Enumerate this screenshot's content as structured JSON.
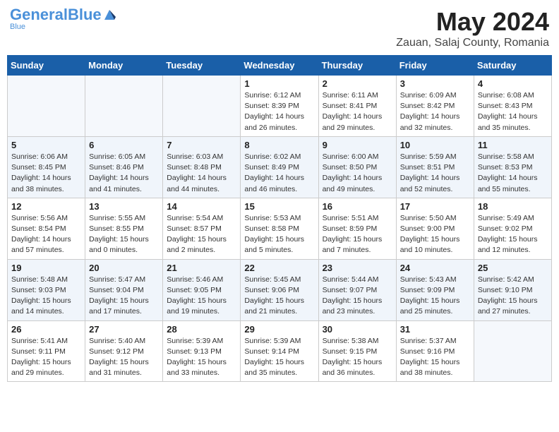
{
  "header": {
    "logo_general": "General",
    "logo_blue": "Blue",
    "month_title": "May 2024",
    "subtitle": "Zauan, Salaj County, Romania"
  },
  "days_of_week": [
    "Sunday",
    "Monday",
    "Tuesday",
    "Wednesday",
    "Thursday",
    "Friday",
    "Saturday"
  ],
  "weeks": [
    [
      {
        "day": "",
        "info": ""
      },
      {
        "day": "",
        "info": ""
      },
      {
        "day": "",
        "info": ""
      },
      {
        "day": "1",
        "info": "Sunrise: 6:12 AM\nSunset: 8:39 PM\nDaylight: 14 hours and 26 minutes."
      },
      {
        "day": "2",
        "info": "Sunrise: 6:11 AM\nSunset: 8:41 PM\nDaylight: 14 hours and 29 minutes."
      },
      {
        "day": "3",
        "info": "Sunrise: 6:09 AM\nSunset: 8:42 PM\nDaylight: 14 hours and 32 minutes."
      },
      {
        "day": "4",
        "info": "Sunrise: 6:08 AM\nSunset: 8:43 PM\nDaylight: 14 hours and 35 minutes."
      }
    ],
    [
      {
        "day": "5",
        "info": "Sunrise: 6:06 AM\nSunset: 8:45 PM\nDaylight: 14 hours and 38 minutes."
      },
      {
        "day": "6",
        "info": "Sunrise: 6:05 AM\nSunset: 8:46 PM\nDaylight: 14 hours and 41 minutes."
      },
      {
        "day": "7",
        "info": "Sunrise: 6:03 AM\nSunset: 8:48 PM\nDaylight: 14 hours and 44 minutes."
      },
      {
        "day": "8",
        "info": "Sunrise: 6:02 AM\nSunset: 8:49 PM\nDaylight: 14 hours and 46 minutes."
      },
      {
        "day": "9",
        "info": "Sunrise: 6:00 AM\nSunset: 8:50 PM\nDaylight: 14 hours and 49 minutes."
      },
      {
        "day": "10",
        "info": "Sunrise: 5:59 AM\nSunset: 8:51 PM\nDaylight: 14 hours and 52 minutes."
      },
      {
        "day": "11",
        "info": "Sunrise: 5:58 AM\nSunset: 8:53 PM\nDaylight: 14 hours and 55 minutes."
      }
    ],
    [
      {
        "day": "12",
        "info": "Sunrise: 5:56 AM\nSunset: 8:54 PM\nDaylight: 14 hours and 57 minutes."
      },
      {
        "day": "13",
        "info": "Sunrise: 5:55 AM\nSunset: 8:55 PM\nDaylight: 15 hours and 0 minutes."
      },
      {
        "day": "14",
        "info": "Sunrise: 5:54 AM\nSunset: 8:57 PM\nDaylight: 15 hours and 2 minutes."
      },
      {
        "day": "15",
        "info": "Sunrise: 5:53 AM\nSunset: 8:58 PM\nDaylight: 15 hours and 5 minutes."
      },
      {
        "day": "16",
        "info": "Sunrise: 5:51 AM\nSunset: 8:59 PM\nDaylight: 15 hours and 7 minutes."
      },
      {
        "day": "17",
        "info": "Sunrise: 5:50 AM\nSunset: 9:00 PM\nDaylight: 15 hours and 10 minutes."
      },
      {
        "day": "18",
        "info": "Sunrise: 5:49 AM\nSunset: 9:02 PM\nDaylight: 15 hours and 12 minutes."
      }
    ],
    [
      {
        "day": "19",
        "info": "Sunrise: 5:48 AM\nSunset: 9:03 PM\nDaylight: 15 hours and 14 minutes."
      },
      {
        "day": "20",
        "info": "Sunrise: 5:47 AM\nSunset: 9:04 PM\nDaylight: 15 hours and 17 minutes."
      },
      {
        "day": "21",
        "info": "Sunrise: 5:46 AM\nSunset: 9:05 PM\nDaylight: 15 hours and 19 minutes."
      },
      {
        "day": "22",
        "info": "Sunrise: 5:45 AM\nSunset: 9:06 PM\nDaylight: 15 hours and 21 minutes."
      },
      {
        "day": "23",
        "info": "Sunrise: 5:44 AM\nSunset: 9:07 PM\nDaylight: 15 hours and 23 minutes."
      },
      {
        "day": "24",
        "info": "Sunrise: 5:43 AM\nSunset: 9:09 PM\nDaylight: 15 hours and 25 minutes."
      },
      {
        "day": "25",
        "info": "Sunrise: 5:42 AM\nSunset: 9:10 PM\nDaylight: 15 hours and 27 minutes."
      }
    ],
    [
      {
        "day": "26",
        "info": "Sunrise: 5:41 AM\nSunset: 9:11 PM\nDaylight: 15 hours and 29 minutes."
      },
      {
        "day": "27",
        "info": "Sunrise: 5:40 AM\nSunset: 9:12 PM\nDaylight: 15 hours and 31 minutes."
      },
      {
        "day": "28",
        "info": "Sunrise: 5:39 AM\nSunset: 9:13 PM\nDaylight: 15 hours and 33 minutes."
      },
      {
        "day": "29",
        "info": "Sunrise: 5:39 AM\nSunset: 9:14 PM\nDaylight: 15 hours and 35 minutes."
      },
      {
        "day": "30",
        "info": "Sunrise: 5:38 AM\nSunset: 9:15 PM\nDaylight: 15 hours and 36 minutes."
      },
      {
        "day": "31",
        "info": "Sunrise: 5:37 AM\nSunset: 9:16 PM\nDaylight: 15 hours and 38 minutes."
      },
      {
        "day": "",
        "info": ""
      }
    ]
  ]
}
